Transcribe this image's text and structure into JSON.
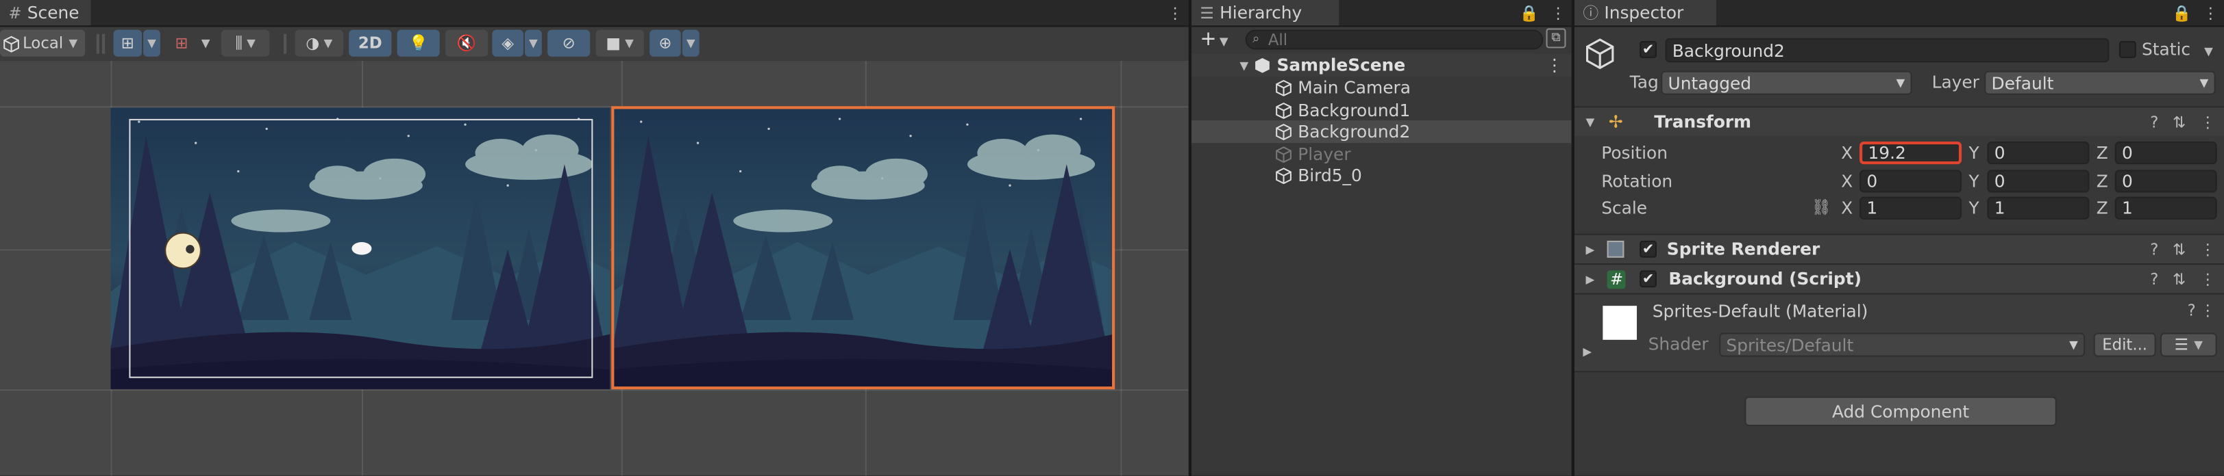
{
  "scene": {
    "tab_label": "Scene",
    "pivot_label": "Local",
    "btn_2d": "2D"
  },
  "hierarchy": {
    "tab_label": "Hierarchy",
    "search_placeholder": "All",
    "scene_name": "SampleScene",
    "items": [
      {
        "label": "Main Camera",
        "selected": false,
        "disabled": false
      },
      {
        "label": "Background1",
        "selected": false,
        "disabled": false
      },
      {
        "label": "Background2",
        "selected": true,
        "disabled": false
      },
      {
        "label": "Player",
        "selected": false,
        "disabled": true
      },
      {
        "label": "Bird5_0",
        "selected": false,
        "disabled": false
      }
    ]
  },
  "inspector": {
    "tab_label": "Inspector",
    "object_name": "Background2",
    "static_label": "Static",
    "tag_label": "Tag",
    "tag_value": "Untagged",
    "layer_label": "Layer",
    "layer_value": "Default",
    "transform": {
      "title": "Transform",
      "position_label": "Position",
      "rotation_label": "Rotation",
      "scale_label": "Scale",
      "axis_x": "X",
      "axis_y": "Y",
      "axis_z": "Z",
      "position": {
        "x": "19.2",
        "y": "0",
        "z": "0"
      },
      "rotation": {
        "x": "0",
        "y": "0",
        "z": "0"
      },
      "scale": {
        "x": "1",
        "y": "1",
        "z": "1"
      }
    },
    "sprite_renderer_title": "Sprite Renderer",
    "script_title": "Background (Script)",
    "material_name": "Sprites-Default (Material)",
    "shader_label": "Shader",
    "shader_value": "Sprites/Default",
    "edit_button": "Edit...",
    "add_component_button": "Add Component"
  },
  "colors": {
    "selection_outline": "#e8743b",
    "highlight_box": "#e0442e",
    "panel_bg": "#383838",
    "scene_bg": "#474747"
  }
}
